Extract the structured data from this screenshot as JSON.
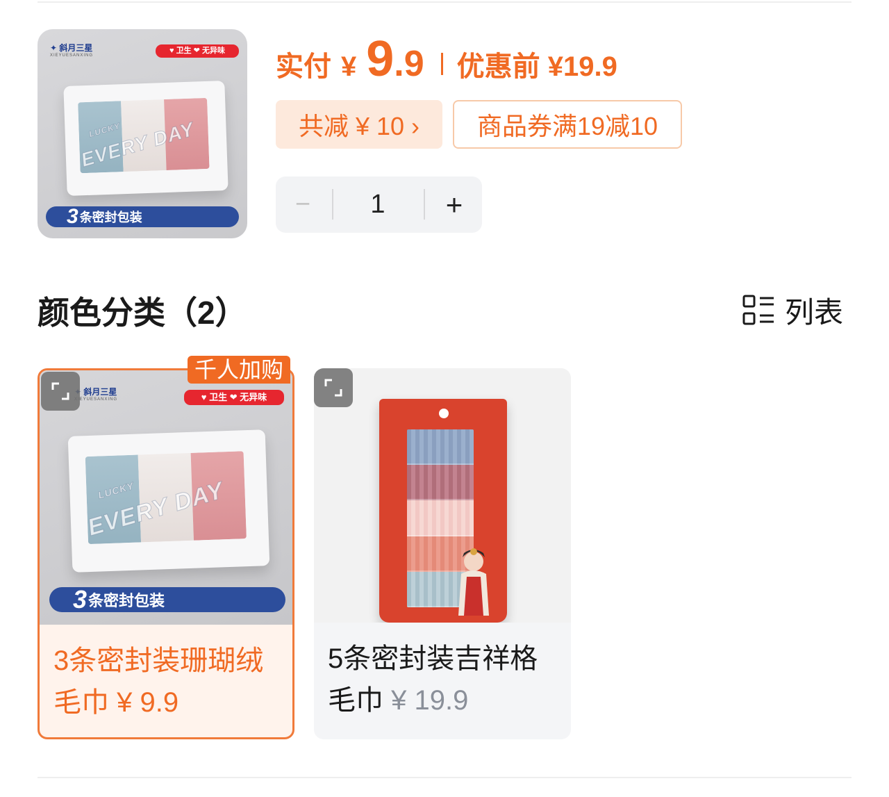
{
  "product": {
    "thumbnail": {
      "brand": "斜月三星",
      "brand_sub": "XIEYUESANXING",
      "tags": "卫生 ❤ 无异味",
      "box_text": "EVERY DAY",
      "box_text_small": "LUCKY",
      "banner_num": "3",
      "banner_text": "条密封包装"
    },
    "price": {
      "paid_label": "实付",
      "currency": "¥",
      "amount_int": "9",
      "amount_dec": ".9",
      "before_label": "优惠前 ¥19.9"
    },
    "discount_tag": "共减 ¥ 10 ›",
    "coupon_tag": "商品券满19减10",
    "quantity": {
      "minus": "−",
      "value": "1",
      "plus": "+"
    }
  },
  "section": {
    "title": "颜色分类（2）",
    "view_toggle_label": "列表",
    "view_toggle_icon": "list-view-icon"
  },
  "variants": [
    {
      "badge": "千人加购",
      "name": "3条密封装珊瑚绒毛巾",
      "price": "¥ 9.9",
      "selected": true,
      "brand": "斜月三星",
      "brand_sub": "XIEYUESANXING",
      "tags": "卫生 ❤ 无异味",
      "box_text": "EVERY DAY",
      "box_text_small": "LUCKY",
      "banner_num": "3",
      "banner_text": "条密封包装"
    },
    {
      "name": "5条密封装吉祥格毛巾",
      "price": "¥ 19.9",
      "selected": false
    }
  ],
  "colors": {
    "accent": "#f06a23",
    "accent_bg": "#fde9dc",
    "banner_blue": "#2d4e9c",
    "tag_red": "#e6262f"
  }
}
